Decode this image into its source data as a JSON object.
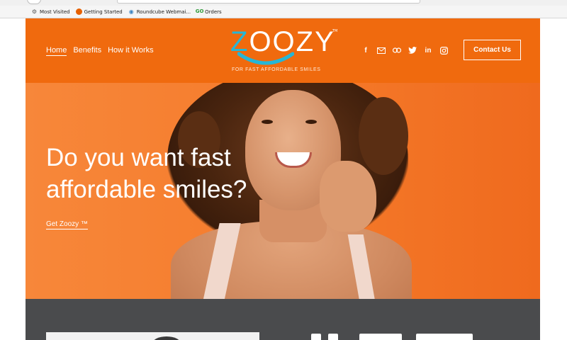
{
  "browser": {
    "bookmarks": [
      {
        "label": "Most Visited",
        "icon": "gear-icon"
      },
      {
        "label": "Getting Started",
        "icon": "firefox-icon"
      },
      {
        "label": "Roundcube Webmai...",
        "icon": "roundcube-icon"
      },
      {
        "label": "Orders",
        "icon": "go-icon"
      }
    ]
  },
  "header": {
    "nav": [
      {
        "label": "Home",
        "active": true
      },
      {
        "label": "Benefits",
        "active": false
      },
      {
        "label": "How it Works",
        "active": false
      }
    ],
    "logo": {
      "word_first": "Z",
      "word_rest": "OOZY",
      "trademark": "TM",
      "tagline": "FOR FAST AFFORDABLE SMILES"
    },
    "social_icons": [
      "facebook-icon",
      "email-icon",
      "link-icon",
      "twitter-icon",
      "linkedin-icon",
      "instagram-icon"
    ],
    "contact_label": "Contact Us"
  },
  "hero": {
    "title_line1": "Do you want fast",
    "title_line2": "affordable smiles?",
    "cta_label": "Get Zoozy ™"
  },
  "colors": {
    "brand_orange": "#f06a0e",
    "logo_teal": "#26b6d6",
    "dark_section": "#4a4b4d"
  }
}
